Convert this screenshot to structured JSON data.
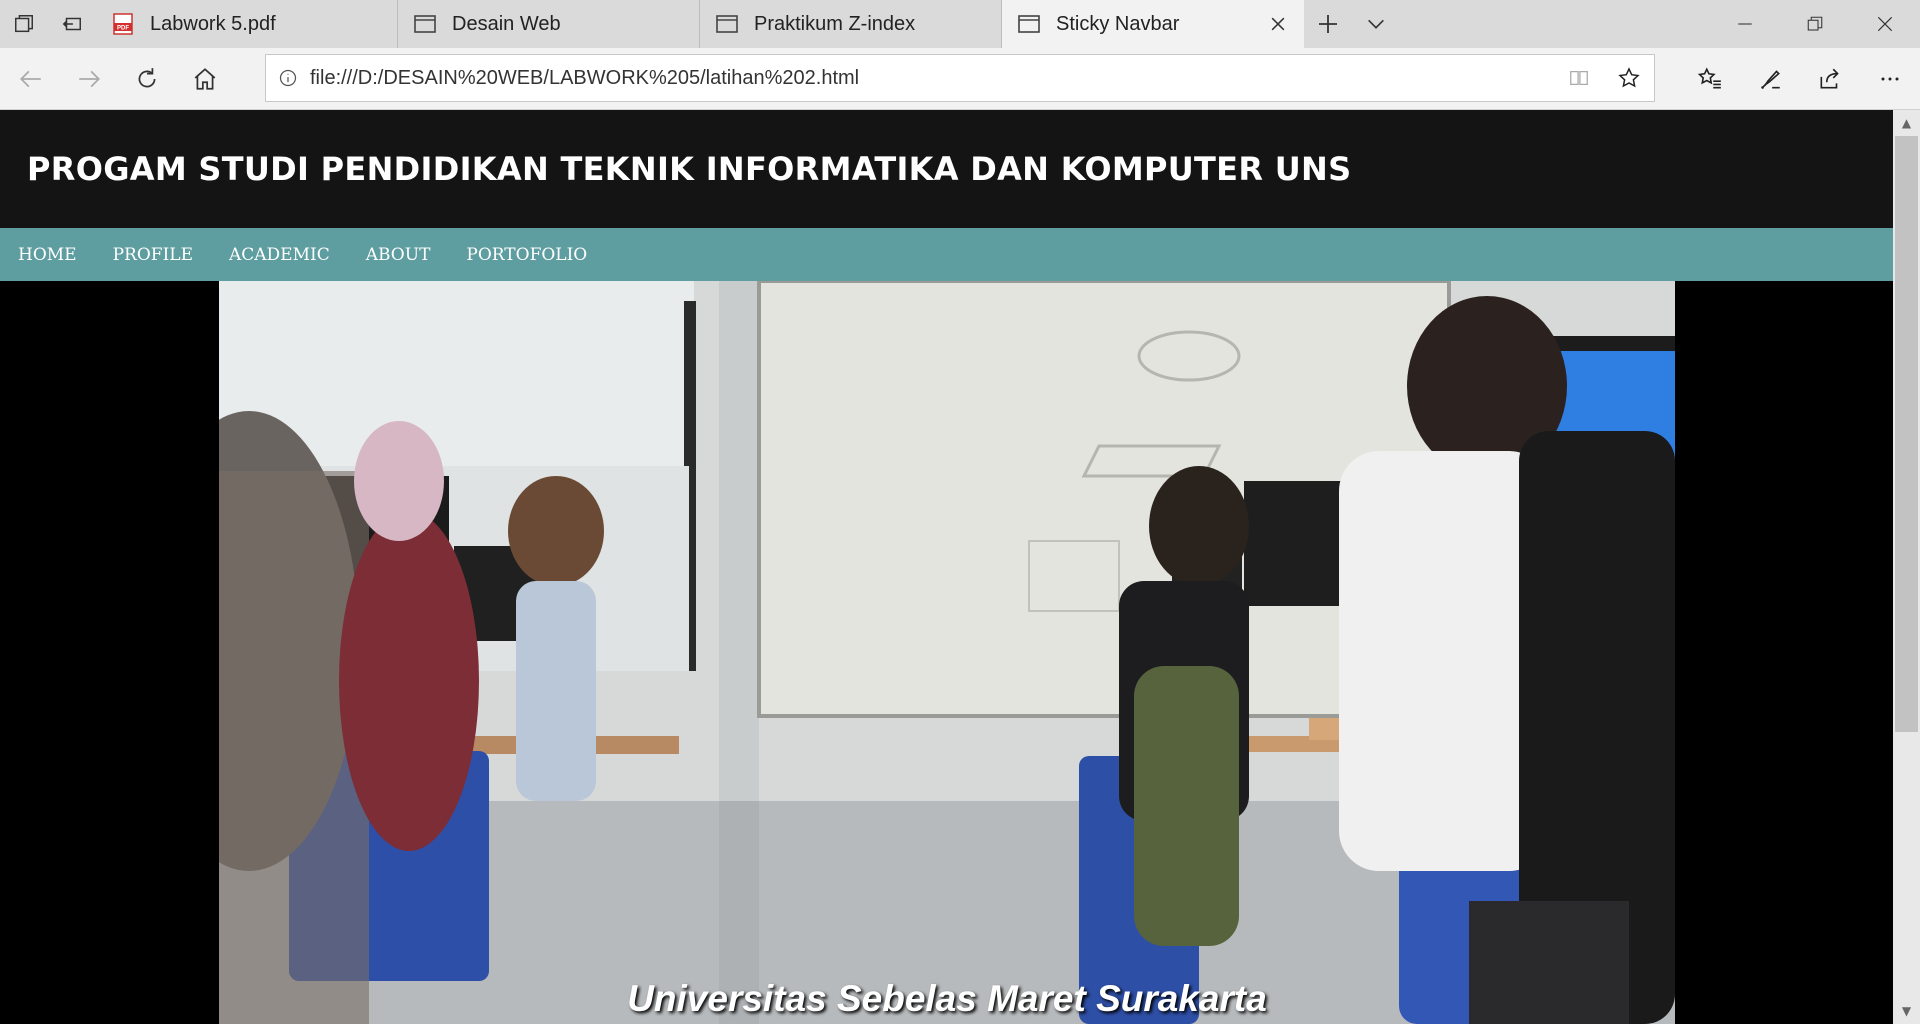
{
  "browser": {
    "tabs": [
      {
        "label": "Labwork 5.pdf",
        "icon": "pdf-icon"
      },
      {
        "label": "Desain Web",
        "icon": "page-icon"
      },
      {
        "label": "Praktikum Z-index",
        "icon": "page-icon"
      },
      {
        "label": "Sticky Navbar",
        "icon": "page-icon",
        "active": true
      }
    ],
    "address": {
      "url": "file:///D:/DESAIN%20WEB/LABWORK%205/latihan%202.html"
    }
  },
  "site": {
    "title": "PROGAM STUDI PENDIDIKAN TEKNIK INFORMATIKA DAN KOMPUTER UNS",
    "nav": [
      "HOME",
      "PROFILE",
      "ACADEMIC",
      "ABOUT",
      "PORTOFOLIO"
    ],
    "hero_caption": "Universitas Sebelas Maret Surakarta"
  },
  "colors": {
    "header_bg": "#141414",
    "navbar_bg": "#5f9ea0",
    "page_bg": "#000000"
  }
}
